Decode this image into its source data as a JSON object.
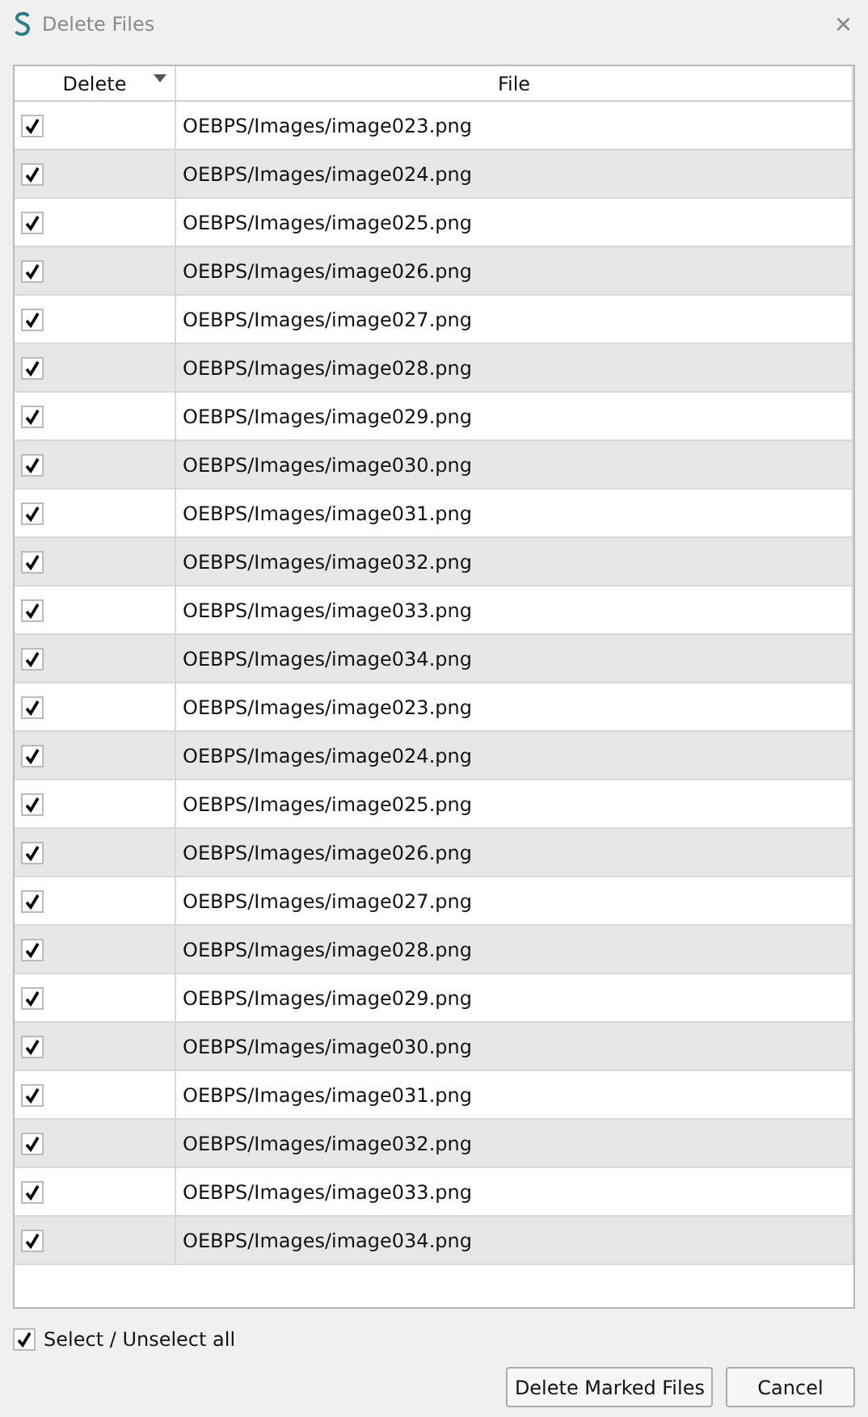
{
  "window": {
    "title": "Delete Files",
    "close": "×"
  },
  "table": {
    "columns": [
      {
        "label": "Delete",
        "sorted": true
      },
      {
        "label": "File",
        "sorted": false
      }
    ],
    "rows": [
      {
        "checked": true,
        "file": "OEBPS/Images/image023.png"
      },
      {
        "checked": true,
        "file": "OEBPS/Images/image024.png"
      },
      {
        "checked": true,
        "file": "OEBPS/Images/image025.png"
      },
      {
        "checked": true,
        "file": "OEBPS/Images/image026.png"
      },
      {
        "checked": true,
        "file": "OEBPS/Images/image027.png"
      },
      {
        "checked": true,
        "file": "OEBPS/Images/image028.png"
      },
      {
        "checked": true,
        "file": "OEBPS/Images/image029.png"
      },
      {
        "checked": true,
        "file": "OEBPS/Images/image030.png"
      },
      {
        "checked": true,
        "file": "OEBPS/Images/image031.png"
      },
      {
        "checked": true,
        "file": "OEBPS/Images/image032.png"
      },
      {
        "checked": true,
        "file": "OEBPS/Images/image033.png"
      },
      {
        "checked": true,
        "file": "OEBPS/Images/image034.png"
      },
      {
        "checked": true,
        "file": "OEBPS/Images/image023.png"
      },
      {
        "checked": true,
        "file": "OEBPS/Images/image024.png"
      },
      {
        "checked": true,
        "file": "OEBPS/Images/image025.png"
      },
      {
        "checked": true,
        "file": "OEBPS/Images/image026.png"
      },
      {
        "checked": true,
        "file": "OEBPS/Images/image027.png"
      },
      {
        "checked": true,
        "file": "OEBPS/Images/image028.png"
      },
      {
        "checked": true,
        "file": "OEBPS/Images/image029.png"
      },
      {
        "checked": true,
        "file": "OEBPS/Images/image030.png"
      },
      {
        "checked": true,
        "file": "OEBPS/Images/image031.png"
      },
      {
        "checked": true,
        "file": "OEBPS/Images/image032.png"
      },
      {
        "checked": true,
        "file": "OEBPS/Images/image033.png"
      },
      {
        "checked": true,
        "file": "OEBPS/Images/image034.png"
      }
    ]
  },
  "select_all": {
    "label": "Select / Unselect all",
    "checked": true
  },
  "buttons": [
    "Delete Marked Files",
    "Cancel"
  ]
}
